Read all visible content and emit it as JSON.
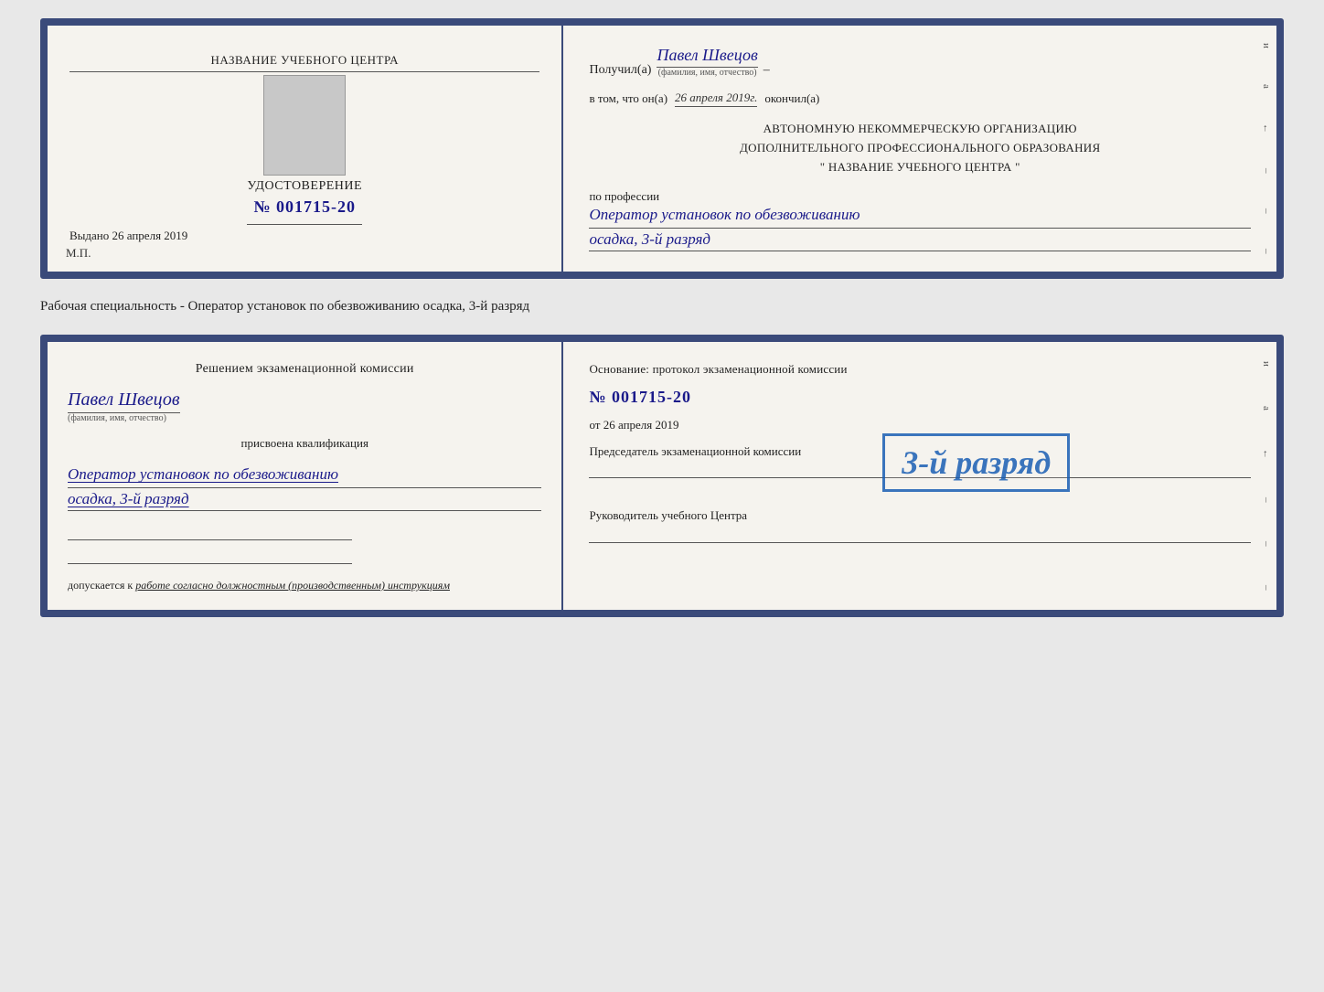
{
  "page": {
    "background": "#e8e8e8"
  },
  "specialty_line": "Рабочая специальность - Оператор установок по обезвоживанию осадка, 3-й разряд",
  "top_doc": {
    "left": {
      "training_center": "НАЗВАНИЕ УЧЕБНОГО ЦЕНТРА",
      "certificate_label": "УДОСТОВЕРЕНИЕ",
      "certificate_number": "№ 001715-20",
      "issued_label": "Выдано",
      "issued_date": "26 апреля 2019",
      "mp_label": "М.П."
    },
    "right": {
      "received_label": "Получил(а)",
      "recipient_name": "Павел Швецов",
      "fio_note": "(фамилия, имя, отчество)",
      "confirm_prefix": "в том, что он(а)",
      "confirm_date": "26 апреля 2019г.",
      "confirm_suffix": "окончил(а)",
      "org_line1": "АВТОНОМНУЮ НЕКОММЕРЧЕСКУЮ ОРГАНИЗАЦИЮ",
      "org_line2": "ДОПОЛНИТЕЛЬНОГО ПРОФЕССИОНАЛЬНОГО ОБРАЗОВАНИЯ",
      "org_line3": "\"   НАЗВАНИЕ УЧЕБНОГО ЦЕНТРА   \"",
      "profession_label": "по профессии",
      "profession_value": "Оператор установок по обезвоживанию",
      "rank_value": "осадка, 3-й разряд"
    },
    "edge_chars": [
      "и",
      "а",
      "←",
      "–",
      "–",
      "–"
    ]
  },
  "bottom_doc": {
    "left": {
      "commission_title": "Решением экзаменационной комиссии",
      "person_name": "Павел Швецов",
      "fio_note": "(фамилия, имя, отчество)",
      "qualification_label": "присвоена квалификация",
      "qualification_value": "Оператор установок по обезвоживанию",
      "rank_value": "осадка, 3-й разряд",
      "допускается_label": "допускается к",
      "допускается_value": "работе согласно должностным (производственным) инструкциям"
    },
    "right": {
      "osnov_label": "Основание: протокол экзаменационной комиссии",
      "protocol_number": "№ 001715-20",
      "from_label": "от",
      "from_date": "26 апреля 2019",
      "predsedatel_label": "Председатель экзаменационной комиссии",
      "rukovoditel_label": "Руководитель учебного Центра"
    },
    "stamp": {
      "text": "3-й разряд"
    },
    "edge_chars": [
      "и",
      "а",
      "←",
      "–",
      "–",
      "–"
    ]
  }
}
